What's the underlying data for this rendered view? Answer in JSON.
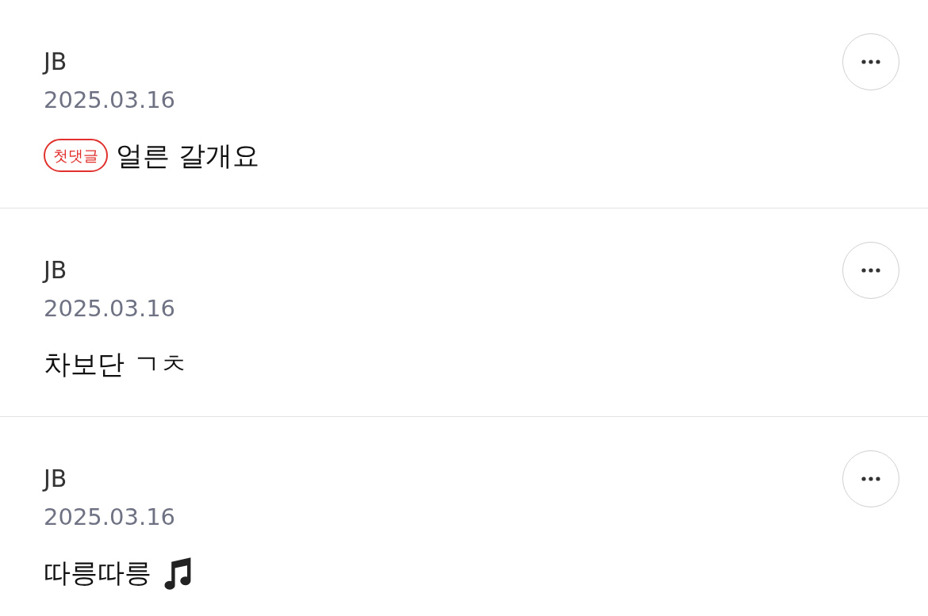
{
  "comments": [
    {
      "author": "JB",
      "date": "2025.03.16",
      "badge": "첫댓글",
      "text": "얼른 갈개요"
    },
    {
      "author": "JB",
      "date": "2025.03.16",
      "text": "차보단 ㄱㅊ"
    },
    {
      "author": "JB",
      "date": "2025.03.16",
      "text": "따릉따릉",
      "music_icon": true
    }
  ]
}
